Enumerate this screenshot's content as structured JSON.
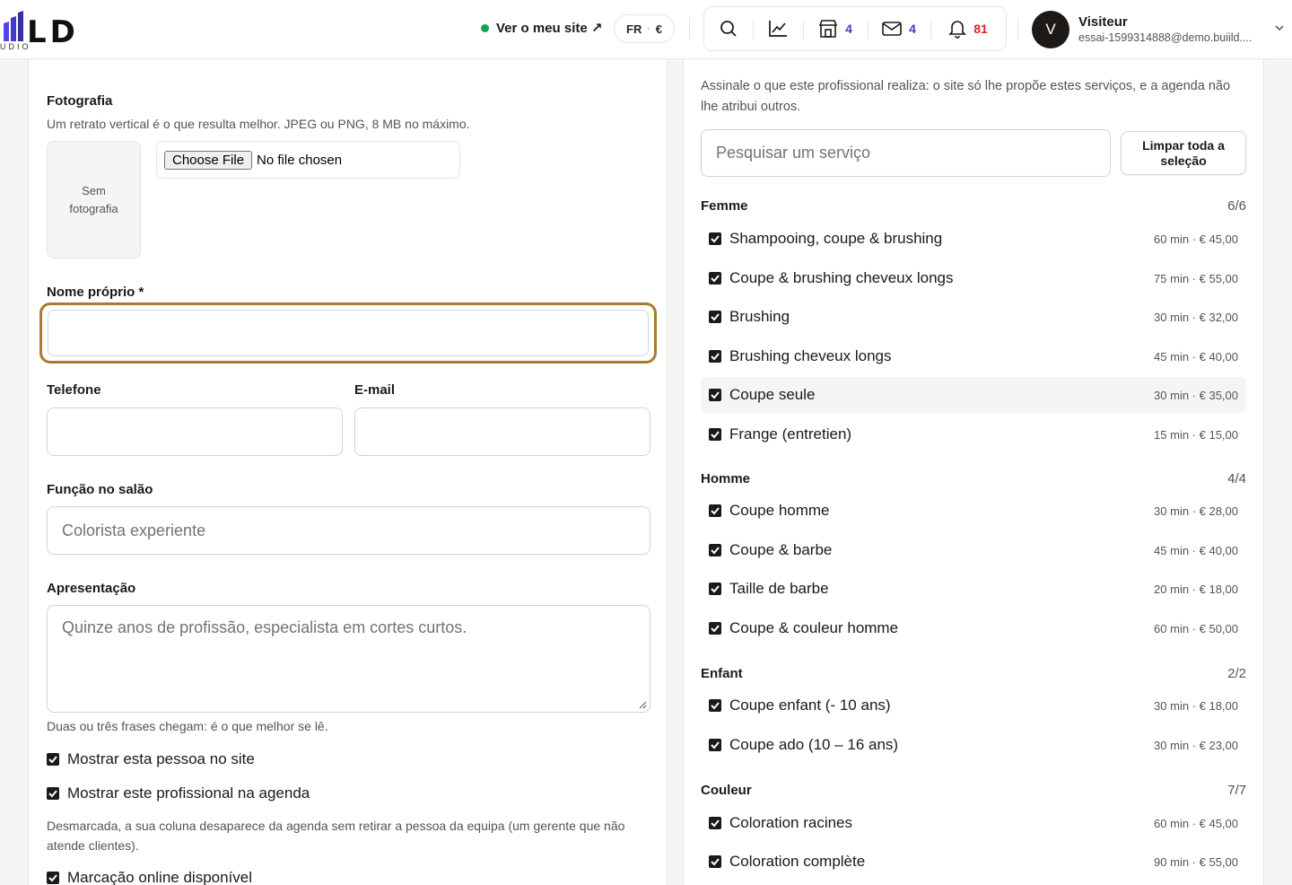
{
  "header": {
    "logo_text": "LD",
    "logo_sub": "UDIO",
    "site_link": "Ver o meu site ↗",
    "lang": "FR",
    "currency": "€",
    "icons": {
      "shop_count": "4",
      "mail_count": "4",
      "bell_count": "81"
    },
    "user": {
      "initial": "V",
      "name": "Visiteur",
      "email": "essai-1599314888@demo.buiild...."
    }
  },
  "form": {
    "photo": {
      "label": "Fotografia",
      "help": "Um retrato vertical é o que resulta melhor. JPEG ou PNG, 8 MB no máximo.",
      "placeholder": "Sem fotografia",
      "choose_file": "Choose File",
      "no_file": "No file chosen"
    },
    "first_name": {
      "label": "Nome próprio *",
      "value": ""
    },
    "phone": {
      "label": "Telefone",
      "value": ""
    },
    "email": {
      "label": "E-mail",
      "value": ""
    },
    "role": {
      "label": "Função no salão",
      "placeholder": "Colorista experiente"
    },
    "bio": {
      "label": "Apresentação",
      "placeholder": "Quinze anos de profissão, especialista em cortes curtos.",
      "help": "Duas ou três frases chegam: é o que melhor se lê."
    },
    "show_on_site": {
      "label": "Mostrar esta pessoa no site",
      "checked": true
    },
    "show_in_agenda": {
      "label": "Mostrar este profissional na agenda",
      "checked": true,
      "help": "Desmarcada, a sua coluna desaparece da agenda sem retirar a pessoa da equipa (um gerente que não atende clientes)."
    },
    "online_booking": {
      "label": "Marcação online disponível",
      "checked": true
    }
  },
  "services": {
    "intro": "Assinale o que este profissional realiza: o site só lhe propõe estes serviços, e a agenda não lhe atribui outros.",
    "search_placeholder": "Pesquisar um serviço",
    "clear_label": "Limpar toda a seleção",
    "categories": [
      {
        "name": "Femme",
        "count": "6/6",
        "items": [
          {
            "name": "Shampooing, coupe & brushing",
            "meta": "60 min · € 45,00",
            "checked": true
          },
          {
            "name": "Coupe & brushing cheveux longs",
            "meta": "75 min · € 55,00",
            "checked": true
          },
          {
            "name": "Brushing",
            "meta": "30 min · € 32,00",
            "checked": true
          },
          {
            "name": "Brushing cheveux longs",
            "meta": "45 min · € 40,00",
            "checked": true
          },
          {
            "name": "Coupe seule",
            "meta": "30 min · € 35,00",
            "checked": true
          },
          {
            "name": "Frange (entretien)",
            "meta": "15 min · € 15,00",
            "checked": true
          }
        ]
      },
      {
        "name": "Homme",
        "count": "4/4",
        "items": [
          {
            "name": "Coupe homme",
            "meta": "30 min · € 28,00",
            "checked": true
          },
          {
            "name": "Coupe & barbe",
            "meta": "45 min · € 40,00",
            "checked": true
          },
          {
            "name": "Taille de barbe",
            "meta": "20 min · € 18,00",
            "checked": true
          },
          {
            "name": "Coupe & couleur homme",
            "meta": "60 min · € 50,00",
            "checked": true
          }
        ]
      },
      {
        "name": "Enfant",
        "count": "2/2",
        "items": [
          {
            "name": "Coupe enfant (- 10 ans)",
            "meta": "30 min · € 18,00",
            "checked": true
          },
          {
            "name": "Coupe ado (10 – 16 ans)",
            "meta": "30 min · € 23,00",
            "checked": true
          }
        ]
      },
      {
        "name": "Couleur",
        "count": "7/7",
        "items": [
          {
            "name": "Coloration racines",
            "meta": "60 min · € 45,00",
            "checked": true
          },
          {
            "name": "Coloration complète",
            "meta": "90 min · € 55,00",
            "checked": true
          }
        ]
      }
    ]
  }
}
